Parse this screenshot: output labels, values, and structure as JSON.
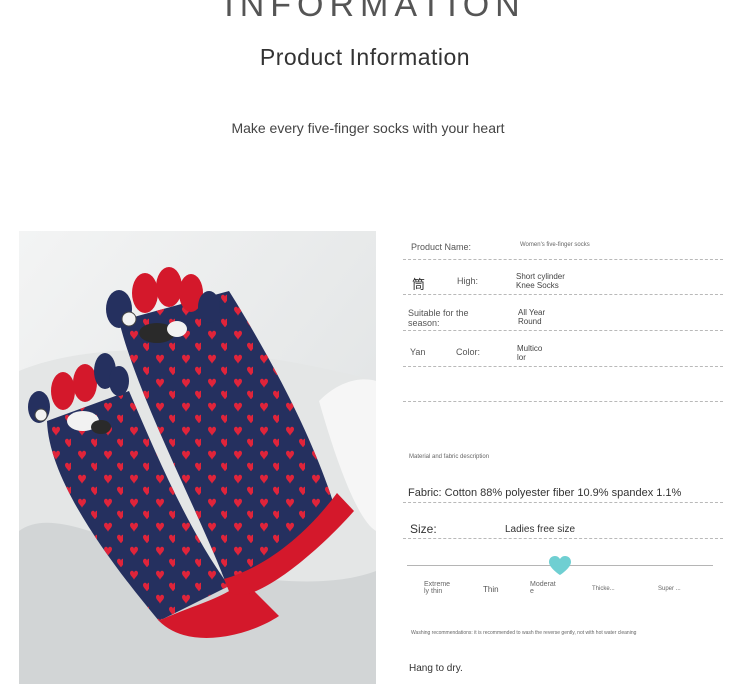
{
  "header": {
    "banner": "INFORMATION",
    "title": "Product Information",
    "subtitle": "Make every five-finger socks with your heart"
  },
  "specs": {
    "product_name_label": "Product Name:",
    "product_name_value": "Women's five-finger socks",
    "char_jian": "筒",
    "high_label": "High:",
    "high_value_1": "Short cylinder",
    "high_value_2": "Knee Socks",
    "season_label_1": "Suitable for the",
    "season_label_2": "season:",
    "season_value_1": "All Year",
    "season_value_2": "Round",
    "yan": "Yan",
    "color_label": "Color:",
    "color_value_1": "Multico",
    "color_value_2": "lor"
  },
  "material": {
    "heading": "Material and fabric description",
    "fabric": "Fabric: Cotton 88% polyester fiber 10.9% spandex 1.1%",
    "size_label": "Size:",
    "size_value": "Ladies free size"
  },
  "thickness": {
    "selected_index": 2,
    "accent_color": "#6fcfd2",
    "levels": [
      {
        "line1": "Extreme",
        "line2": "ly thin"
      },
      {
        "line1": "Thin",
        "line2": ""
      },
      {
        "line1": "Moderat",
        "line2": "e"
      },
      {
        "line1": "Thicke...",
        "line2": ""
      },
      {
        "line1": "Super ...",
        "line2": ""
      }
    ]
  },
  "washing": {
    "note": "Washing recommendations: it is recommended to wash the reverse gently, not with hot water cleaning",
    "hang": "Hang to dry."
  },
  "colors": {
    "sock_navy": "#25305f",
    "sock_red": "#d4182b",
    "heart_red": "#e0243a"
  }
}
